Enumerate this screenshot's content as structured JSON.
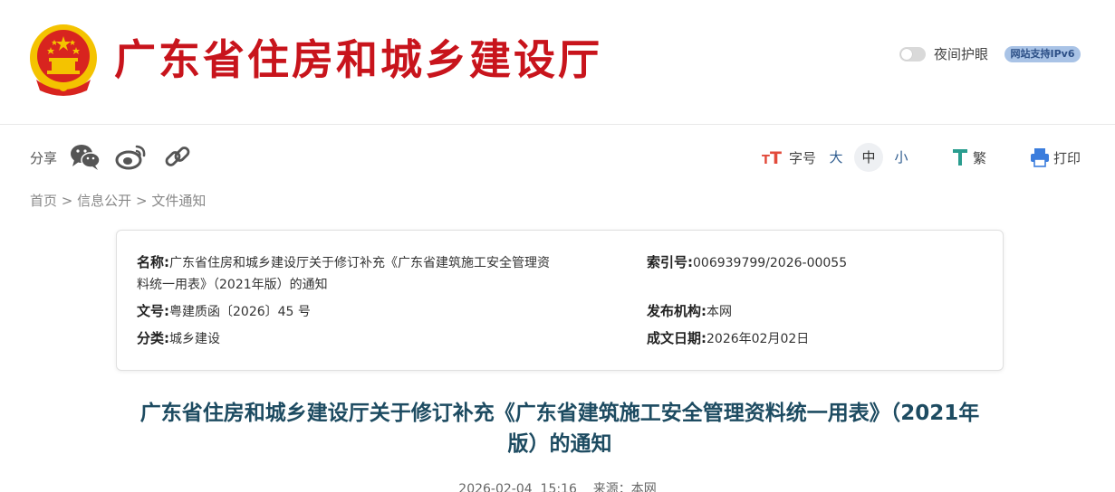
{
  "header": {
    "site_title": "广东省住房和城乡建设厅",
    "night_mode_label": "夜间护眼",
    "ipv6_badge": "网站支持IPv6",
    "emblem_icon": "national-emblem-icon",
    "colors": {
      "title_red": "#c8141c",
      "emblem_red": "#d8241f",
      "emblem_gold": "#f4c300"
    }
  },
  "toolbar": {
    "share_label": "分享",
    "share_icons": [
      "wechat-icon",
      "weibo-icon",
      "link-icon"
    ],
    "font_size_label": "字号",
    "size_large": "大",
    "size_medium": "中",
    "size_small": "小",
    "traditional_label": "繁",
    "print_label": "打印"
  },
  "breadcrumb": {
    "home": "首页",
    "sep1": ">",
    "info": "信息公开",
    "sep2": ">",
    "current": "文件通知"
  },
  "info": {
    "name_label": "名称:",
    "name_line1": "广东省住房和城乡建设厅关于修订补充《广东省建筑施工安全管理资",
    "name_line2": "料统一用表》（2021年版）的通知",
    "index_label": "索引号:",
    "index_value": "006939799/2026-00055",
    "doc_no_label": "文号:",
    "doc_no_value": "粤建质函〔2026〕45 号",
    "publisher_label": "发布机构:",
    "publisher_value": "本网",
    "category_label": "分类:",
    "category_value": "城乡建设",
    "date_label": "成文日期:",
    "date_value": "2026年02月02日"
  },
  "article": {
    "title_line1": "广东省住房和城乡建设厅关于修订补充《广东省建筑施工安全管理资料统一用表》（2021年",
    "title_line2": "版）的通知",
    "meta": "2026-02-04  15:16    来源：本网"
  }
}
